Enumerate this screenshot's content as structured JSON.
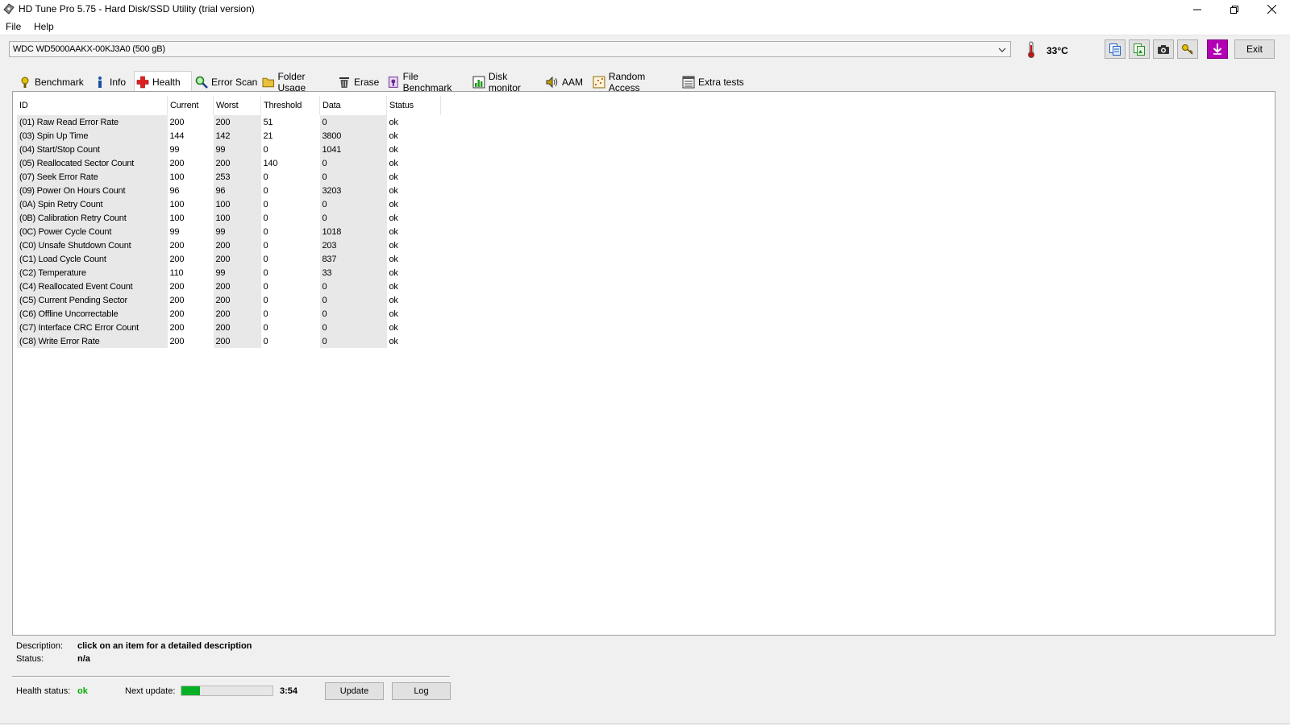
{
  "window": {
    "title": "HD Tune Pro 5.75 - Hard Disk/SSD Utility (trial version)"
  },
  "menu": {
    "file": "File",
    "help": "Help"
  },
  "drive": {
    "selected": "WDC WD5000AAKX-00KJ3A0 (500 gB)",
    "temperature": "33°C"
  },
  "toolbar": {
    "exit_label": "Exit"
  },
  "tabs": [
    {
      "label": "Benchmark",
      "icon": "benchmark-icon"
    },
    {
      "label": "Info",
      "icon": "info-icon"
    },
    {
      "label": "Health",
      "icon": "health-cross-icon",
      "active": true
    },
    {
      "label": "Error Scan",
      "icon": "magnifier-icon"
    },
    {
      "label": "Folder Usage",
      "icon": "folder-icon"
    },
    {
      "label": "Erase",
      "icon": "trash-icon"
    },
    {
      "label": "File Benchmark",
      "icon": "file-benchmark-icon"
    },
    {
      "label": "Disk monitor",
      "icon": "disk-monitor-icon"
    },
    {
      "label": "AAM",
      "icon": "speaker-icon"
    },
    {
      "label": "Random Access",
      "icon": "random-access-icon"
    },
    {
      "label": "Extra tests",
      "icon": "extra-tests-icon"
    }
  ],
  "table": {
    "headers": [
      "ID",
      "Current",
      "Worst",
      "Threshold",
      "Data",
      "Status"
    ],
    "rows": [
      [
        "(01) Raw Read Error Rate",
        "200",
        "200",
        "51",
        "0",
        "ok"
      ],
      [
        "(03) Spin Up Time",
        "144",
        "142",
        "21",
        "3800",
        "ok"
      ],
      [
        "(04) Start/Stop Count",
        "99",
        "99",
        "0",
        "1041",
        "ok"
      ],
      [
        "(05) Reallocated Sector Count",
        "200",
        "200",
        "140",
        "0",
        "ok"
      ],
      [
        "(07) Seek Error Rate",
        "100",
        "253",
        "0",
        "0",
        "ok"
      ],
      [
        "(09) Power On Hours Count",
        "96",
        "96",
        "0",
        "3203",
        "ok"
      ],
      [
        "(0A) Spin Retry Count",
        "100",
        "100",
        "0",
        "0",
        "ok"
      ],
      [
        "(0B) Calibration Retry Count",
        "100",
        "100",
        "0",
        "0",
        "ok"
      ],
      [
        "(0C) Power Cycle Count",
        "99",
        "99",
        "0",
        "1018",
        "ok"
      ],
      [
        "(C0) Unsafe Shutdown Count",
        "200",
        "200",
        "0",
        "203",
        "ok"
      ],
      [
        "(C1) Load Cycle Count",
        "200",
        "200",
        "0",
        "837",
        "ok"
      ],
      [
        "(C2) Temperature",
        "110",
        "99",
        "0",
        "33",
        "ok"
      ],
      [
        "(C4) Reallocated Event Count",
        "200",
        "200",
        "0",
        "0",
        "ok"
      ],
      [
        "(C5) Current Pending Sector",
        "200",
        "200",
        "0",
        "0",
        "ok"
      ],
      [
        "(C6) Offline Uncorrectable",
        "200",
        "200",
        "0",
        "0",
        "ok"
      ],
      [
        "(C7) Interface CRC Error Count",
        "200",
        "200",
        "0",
        "0",
        "ok"
      ],
      [
        "(C8) Write Error Rate",
        "200",
        "200",
        "0",
        "0",
        "ok"
      ]
    ]
  },
  "details": {
    "description_label": "Description:",
    "description_value": "click on an item for a detailed description",
    "status_label": "Status:",
    "status_value": "n/a"
  },
  "health": {
    "status_label": "Health status:",
    "status_value": "ok",
    "next_update_label": "Next update:",
    "next_update_progress": 0.2,
    "countdown": "3:54",
    "update_label": "Update",
    "log_label": "Log"
  },
  "colors": {
    "health_ok": "#00b000",
    "progress_fill": "#06b025",
    "download_button": "#b400b4"
  }
}
